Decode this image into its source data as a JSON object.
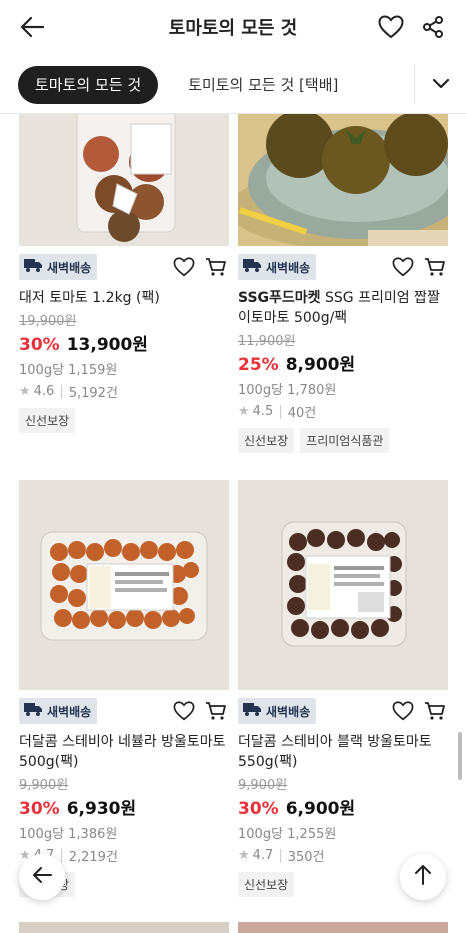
{
  "header": {
    "title": "토마토의 모든 것"
  },
  "tabs": [
    {
      "label": "토마토의 모든 것",
      "active": true
    },
    {
      "label": "토미토의 모든 것 [택배]",
      "active": false
    }
  ],
  "products": [
    {
      "badge": "새벽배송",
      "brand": "",
      "name": "대저 토마토 1.2kg (팩)",
      "original_price": "19,900원",
      "discount": "30%",
      "price": "13,900원",
      "unit_price": "100g당 1,159원",
      "rating": "4.6",
      "reviews": "5,192건",
      "tags": [
        "신선보장"
      ]
    },
    {
      "badge": "새벽배송",
      "brand": "SSG푸드마켓",
      "name": "SSG 프리미엄 짭짤이토마토 500g/팩",
      "original_price": "11,900원",
      "discount": "25%",
      "price": "8,900원",
      "unit_price": "100g당 1,780원",
      "rating": "4.5",
      "reviews": "40건",
      "tags": [
        "신선보장",
        "프리미엄식품관"
      ]
    },
    {
      "badge": "새벽배송",
      "brand": "",
      "name": "더달콤 스테비아 네뷸라 방울토마토 500g(팩)",
      "original_price": "9,900원",
      "discount": "30%",
      "price": "6,930원",
      "unit_price": "100g당 1,386원",
      "rating": "4.7",
      "reviews": "2,219건",
      "tags": [
        "신선보장"
      ]
    },
    {
      "badge": "새벽배송",
      "brand": "",
      "name": "더달콤 스테비아 블랙 방울토마토 550g(팩)",
      "original_price": "9,900원",
      "discount": "30%",
      "price": "6,900원",
      "unit_price": "100g당 1,255원",
      "rating": "4.7",
      "reviews": "350건",
      "tags": [
        "신선보장"
      ]
    }
  ],
  "colors": {
    "accent": "#e8323b",
    "badge_bg": "#dfe4ea",
    "badge_text": "#243350"
  },
  "icons": [
    "back-arrow-icon",
    "heart-icon",
    "share-icon",
    "chevron-down-icon",
    "truck-icon",
    "cart-icon",
    "star-icon",
    "arrow-up-icon"
  ]
}
